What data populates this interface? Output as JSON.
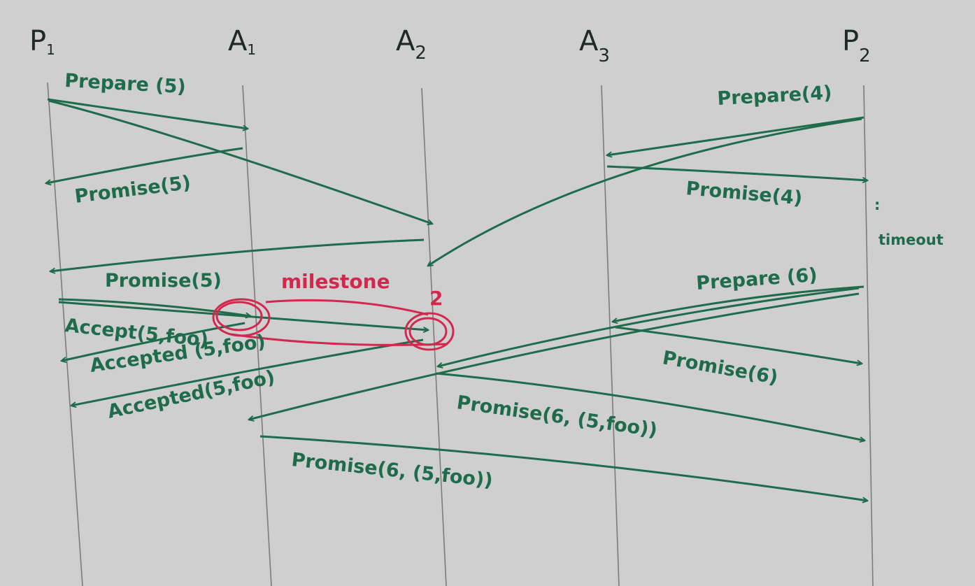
{
  "lanes": {
    "p1": {
      "main": "P",
      "sub": "1"
    },
    "a1": {
      "main": "A",
      "sub": "1"
    },
    "a2": {
      "main": "A",
      "sub": "2"
    },
    "a3": {
      "main": "A",
      "sub": "3"
    },
    "p2": {
      "main": "P",
      "sub": "2"
    }
  },
  "messages": {
    "prepare_5": "Prepare (5)",
    "promise_5_a1": "Promise(5)",
    "promise_5_a2": "Promise(5)",
    "accept_5_foo": "Accept(5,foo)",
    "accepted_a1": "Accepted (5,foo)",
    "accepted_a2": "Accepted(5,foo)",
    "prepare_4": "Prepare(4)",
    "promise_4": "Promise(4)",
    "prepare_6": "Prepare (6)",
    "promise_6": "Promise(6)",
    "promise_6_a2": "Promise(6, (5,foo))",
    "promise_6_a1": "Promise(6, (5,foo))"
  },
  "notes": {
    "dots": ":",
    "timeout": "timeout",
    "milestone": "milestone",
    "milestone_number": "2"
  },
  "colors": {
    "background": "#cfcfcf",
    "ink_green": "#1f6b4d",
    "ink_red": "#d2284d",
    "ink_dark": "#1f2a24"
  }
}
